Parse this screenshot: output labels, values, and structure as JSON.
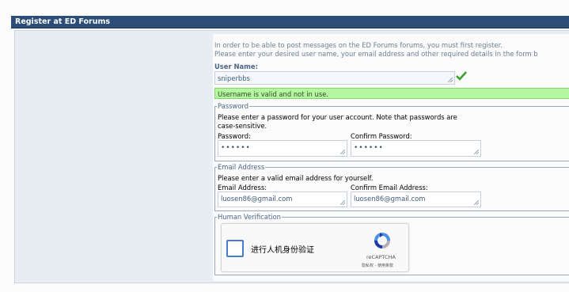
{
  "header": {
    "title": "Register at ED Forums"
  },
  "intro": {
    "line1": "In order to be able to post messages on the ED Forums forums, you must first register.",
    "line2": "Please enter your desired user name, your email address and other required details in the form b"
  },
  "username": {
    "label": "User Name:",
    "value": "sniperbbs",
    "validation_message": "Username is valid and not in use."
  },
  "password_section": {
    "legend": "Password",
    "help_line1": "Please enter a password for your user account. Note that passwords are",
    "help_line2": "case-sensitive.",
    "password_label": "Password:",
    "password_value": "••••••",
    "confirm_label": "Confirm Password:",
    "confirm_value": "••••••"
  },
  "email_section": {
    "legend": "Email Address",
    "help": "Please enter a valid email address for yourself.",
    "email_label": "Email Address:",
    "email_value": "luosen86@gmail.com",
    "confirm_label": "Confirm Email Address:",
    "confirm_value": "luosen86@gmail.com"
  },
  "verification": {
    "legend": "Human Verification",
    "recaptcha_label": "进行人机身份验证",
    "recaptcha_brand": "reCAPTCHA",
    "recaptcha_links": "隐私权 - 使用条款"
  },
  "colors": {
    "header_bg": "#2b4d78",
    "valid_bg": "#b6f7a2",
    "check_green": "#3aa12b"
  }
}
